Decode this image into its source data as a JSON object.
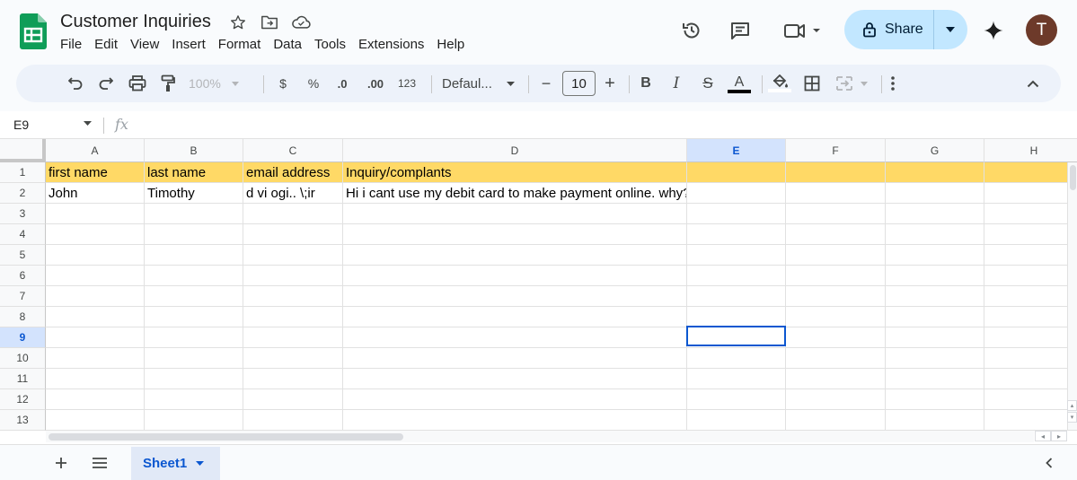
{
  "doc": {
    "title": "Customer Inquiries",
    "menus": [
      "File",
      "Edit",
      "View",
      "Insert",
      "Format",
      "Data",
      "Tools",
      "Extensions",
      "Help"
    ],
    "share_label": "Share",
    "avatar_initial": "T"
  },
  "toolbar": {
    "zoom": "100%",
    "currency": "$",
    "percent": "%",
    "decrease_decimal": ".0",
    "increase_decimal": ".00",
    "number_format": "123",
    "font": "Defaul...",
    "font_size": "10",
    "minus": "−",
    "plus": "+",
    "bold": "B",
    "italic": "I",
    "strike": "S",
    "text_color": "A"
  },
  "formula_bar": {
    "name_box": "E9",
    "fx_label": "fx",
    "value": ""
  },
  "grid": {
    "columns": [
      "A",
      "B",
      "C",
      "D",
      "E",
      "F",
      "G",
      "H"
    ],
    "selected_column": "E",
    "row_numbers": [
      "1",
      "2",
      "3",
      "4",
      "5",
      "6",
      "7",
      "8",
      "9",
      "10",
      "11",
      "12",
      "13"
    ],
    "selected_row": "9",
    "header_fill": "#ffd966",
    "rows": [
      [
        "first name",
        "last name",
        "email address",
        "Inquiry/complants",
        "",
        "",
        "",
        ""
      ],
      [
        "John",
        "Timothy",
        "d  vi  ogi..     \\;ir",
        "Hi i cant use my debit card to make payment online. why?",
        "",
        "",
        "",
        ""
      ]
    ]
  },
  "sheets": {
    "tabs": [
      "Sheet1"
    ],
    "active": "Sheet1"
  },
  "colors": {
    "accent": "#0b57d0",
    "share_bg": "#c2e7ff",
    "toolbar_bg": "#edf2fa",
    "logo_green": "#0f9d58"
  }
}
